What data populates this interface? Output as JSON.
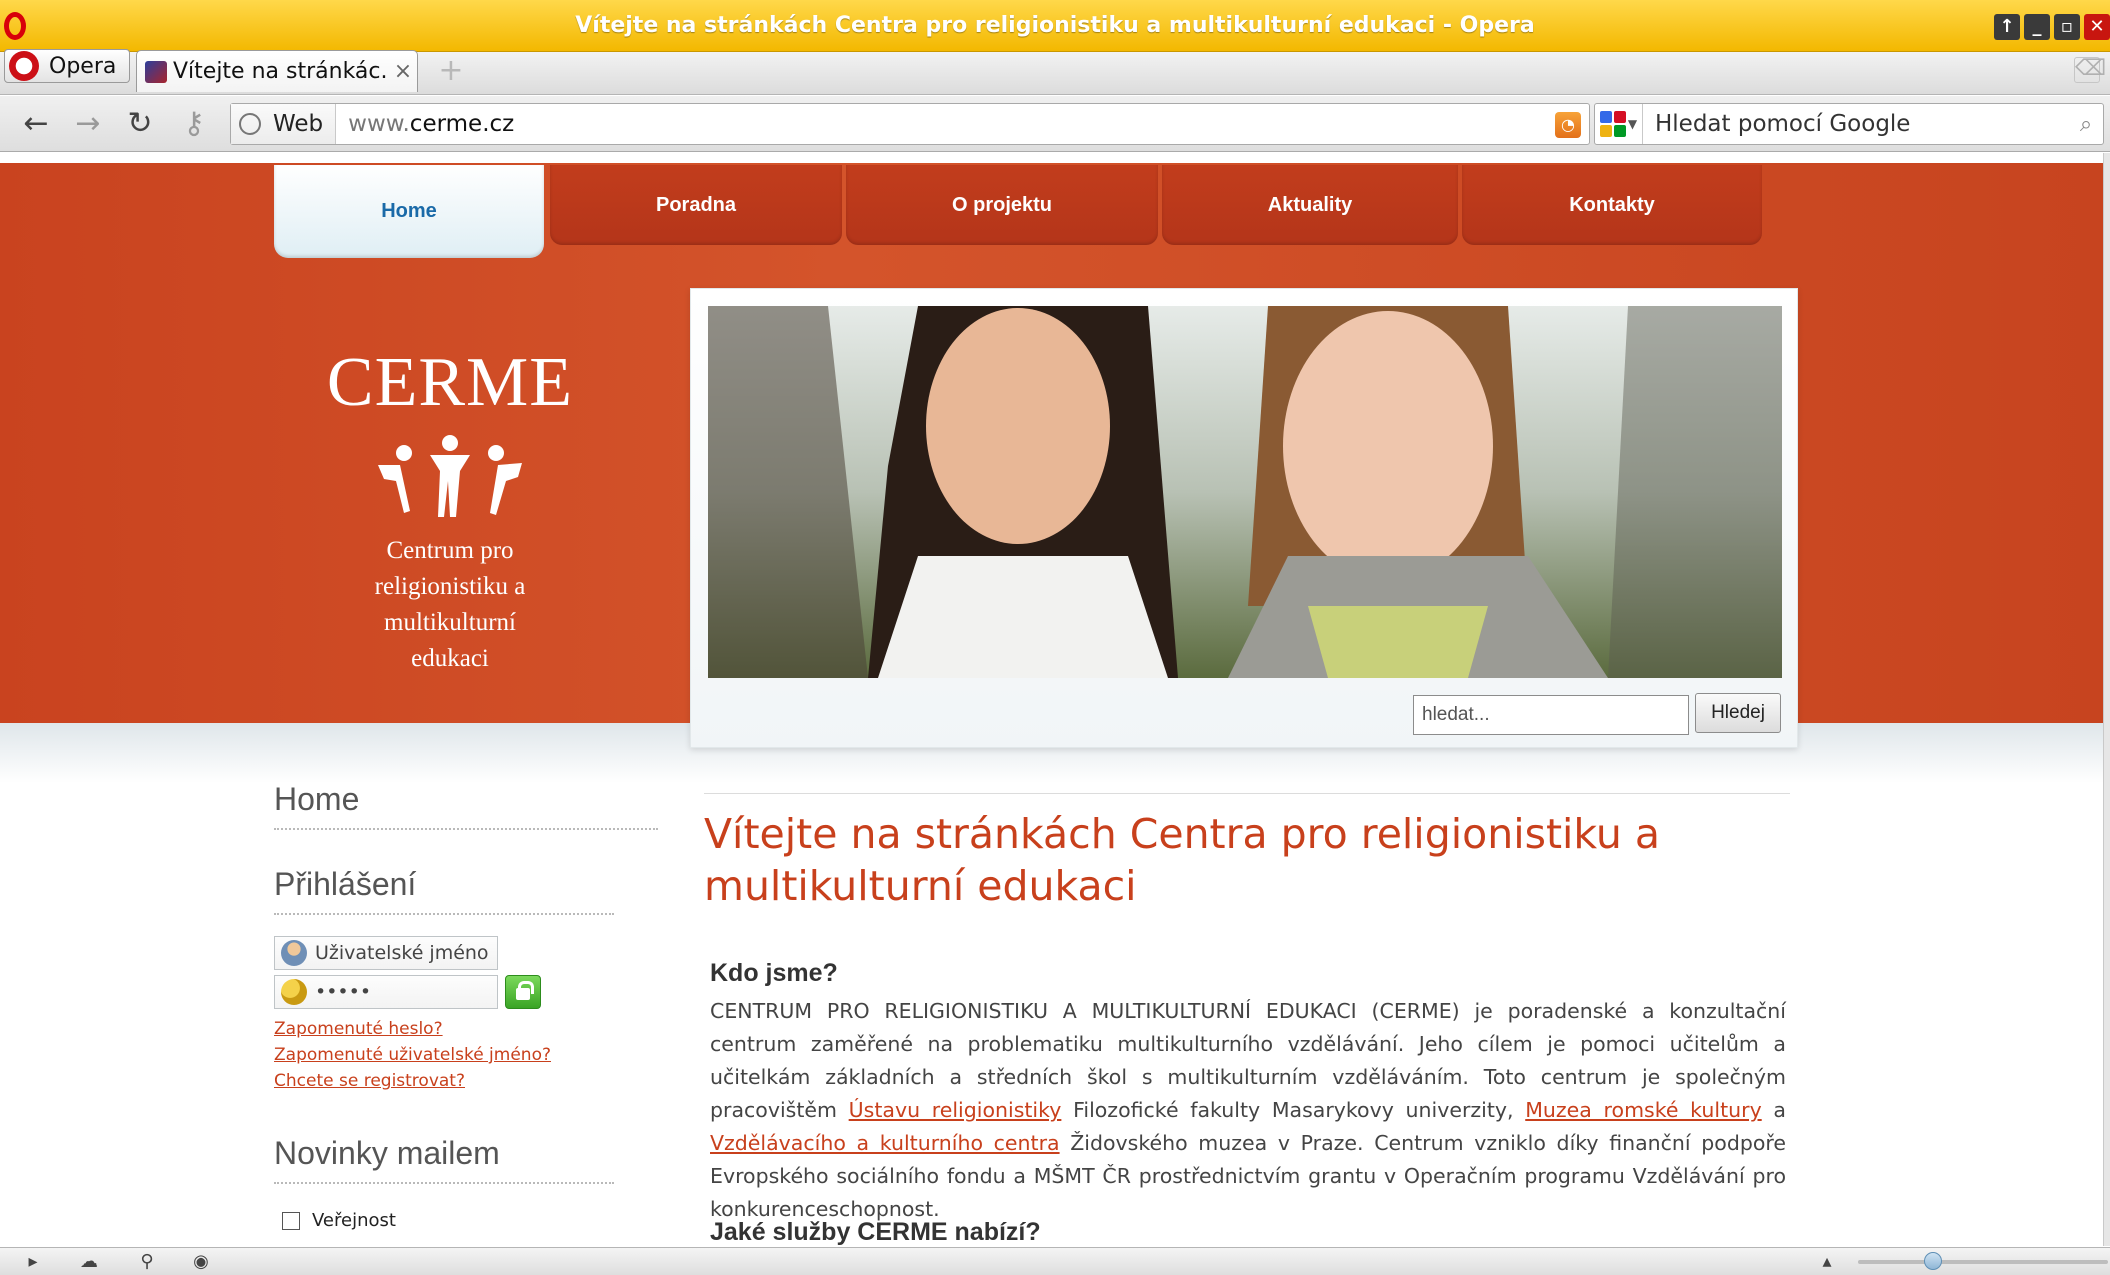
{
  "window": {
    "title": "Vítejte na stránkách Centra pro religionistiku a multikulturní edukaci - Opera"
  },
  "browser": {
    "menu_label": "Opera",
    "tab_title": "Vítejte na stránkác...",
    "tab_close": "×",
    "address_prefix_label": "Web",
    "url_prefix": "www.",
    "url_domain": "cerme.cz",
    "search_placeholder": "Hledat pomocí Google"
  },
  "site": {
    "nav": [
      "Home",
      "Poradna",
      "O projektu",
      "Aktuality",
      "Kontakty"
    ],
    "logo_brand": "CERME",
    "logo_tagline_lines": [
      "Centrum pro",
      "religionistiku a",
      "multikulturní",
      "edukaci"
    ],
    "search_placeholder": "hledat...",
    "search_button": "Hledej"
  },
  "sidebar": {
    "home": "Home",
    "login_heading": "Přihlášení",
    "username_placeholder": "Uživatelské jméno",
    "password_mask": "•••••",
    "links": [
      "Zapomenuté heslo?",
      "Zapomenuté uživatelské jméno?",
      "Chcete se registrovat?"
    ],
    "news_heading": "Novinky mailem",
    "news_option": "Veřejnost"
  },
  "main": {
    "title": "Vítejte na stránkách Centra pro religionistiku a multikulturní edukaci",
    "section1_heading": "Kdo jsme?",
    "para_part1": "CENTRUM PRO RELIGIONISTIKU A MULTIKULTURNÍ EDUKACI (CERME) je poradenské a konzultační centrum zaměřené na problematiku multikulturního vzdělávání. Jeho cílem je pomoci učitelům a učitelkám základních a středních škol s multikulturním vzděláváním. Toto centrum je společným pracovištěm ",
    "link1": "Ústavu religionistiky",
    "para_part2": " Filozofické fakulty Masarykovy univerzity, ",
    "link2": "Muzea romské kultury",
    "para_part3": " a ",
    "link3": "Vzdělávacího a kulturního centra",
    "para_part4": " Židovského muzea v Praze. Centrum vzniklo díky finanční podpoře Evropského sociálního fondu a MŠMT ČR prostřednictvím grantu v Operačním programu Vzdělávání pro konkurenceschopnost.",
    "section2_heading": "Jaké služby CERME nabízí?"
  },
  "colors": {
    "brand_orange": "#c8401c",
    "titlebar_yellow": "#f3b800",
    "active_tab_text": "#1a6aa8"
  }
}
